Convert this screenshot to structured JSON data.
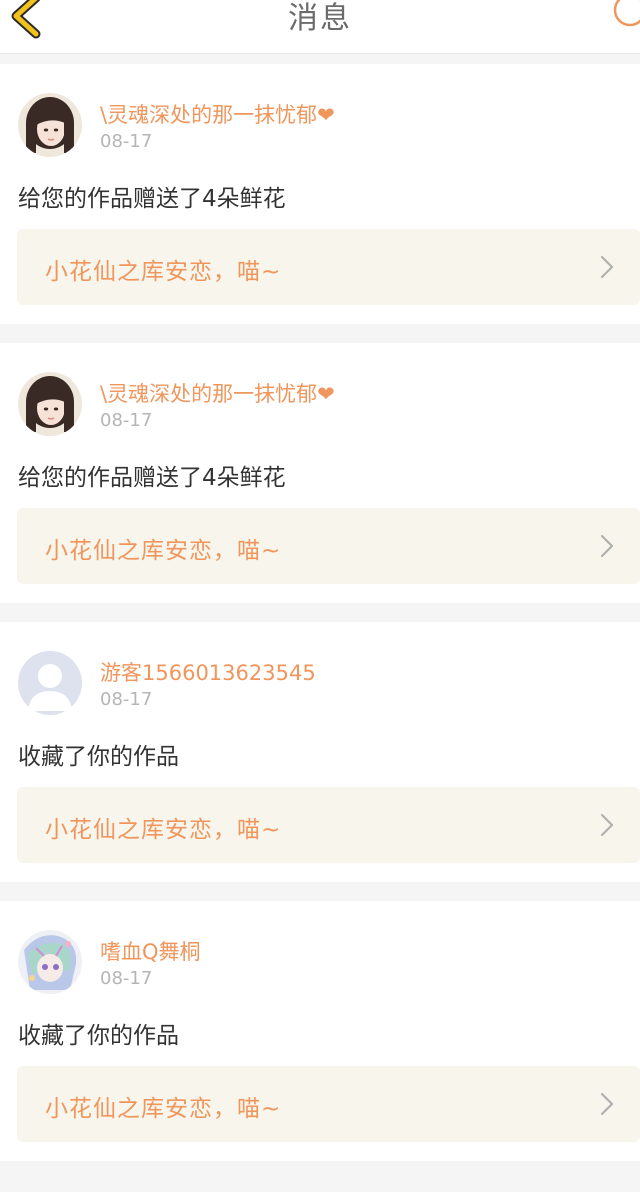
{
  "header": {
    "title": "消息"
  },
  "messages": [
    {
      "username": "\\灵魂深处的那一抹忧郁❤",
      "date": "08-17",
      "action": "给您的作品赠送了4朵鲜花",
      "work_title": "小花仙之库安恋，喵~",
      "avatar": "girl-photo-avatar"
    },
    {
      "username": "\\灵魂深处的那一抹忧郁❤",
      "date": "08-17",
      "action": "给您的作品赠送了4朵鲜花",
      "work_title": "小花仙之库安恋，喵~",
      "avatar": "girl-photo-avatar"
    },
    {
      "username": "游客1566013623545",
      "date": "08-17",
      "action": "收藏了你的作品",
      "work_title": "小花仙之库安恋，喵~",
      "avatar": "default-user-avatar"
    },
    {
      "username": "嗜血Q舞桐",
      "date": "08-17",
      "action": "收藏了你的作品",
      "work_title": "小花仙之库安恋，喵~",
      "avatar": "anime-character-avatar"
    }
  ],
  "colors": {
    "accent": "#f0965c",
    "link_bg": "#f7f5ec",
    "back_icon": "#f2c21b"
  }
}
